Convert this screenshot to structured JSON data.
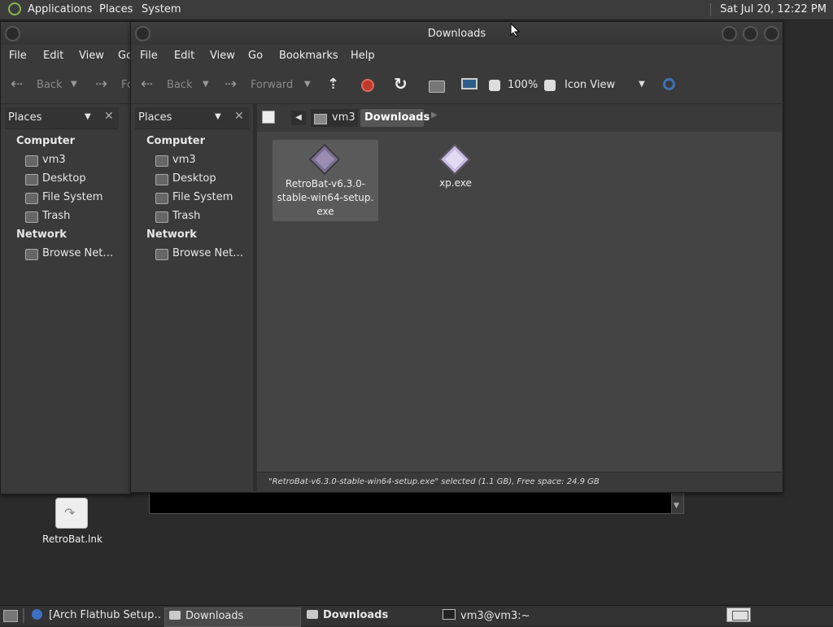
{
  "top_panel": {
    "menus": [
      "Applications",
      "Places",
      "System"
    ],
    "clock": "Sat Jul 20, 12:22 PM"
  },
  "back_window": {
    "menus": [
      "File",
      "Edit",
      "View",
      "Go"
    ],
    "toolbar": {
      "back": "Back",
      "forward": "Fo"
    },
    "places_label": "Places",
    "computer_header": "Computer",
    "items": [
      "vm3",
      "Desktop",
      "File System",
      "Trash"
    ],
    "network_header": "Network",
    "network_items": [
      "Browse Net…"
    ]
  },
  "main_window": {
    "title": "Downloads",
    "menus": [
      "File",
      "Edit",
      "View",
      "Go",
      "Bookmarks",
      "Help"
    ],
    "toolbar": {
      "back": "Back",
      "forward": "Forward",
      "zoom": "100%",
      "view_mode": "Icon View"
    },
    "places_label": "Places",
    "computer_header": "Computer",
    "items": [
      "vm3",
      "Desktop",
      "File System",
      "Trash"
    ],
    "network_header": "Network",
    "network_items": [
      "Browse Net…"
    ],
    "path": [
      "vm3",
      "Downloads"
    ],
    "files": [
      {
        "name_lines": [
          "RetroBat-v6.3.0-",
          "stable-win64-setup.",
          "exe"
        ],
        "selected": true
      },
      {
        "name_lines": [
          "xp.exe"
        ],
        "selected": false
      }
    ],
    "status": "\"RetroBat-v6.3.0-stable-win64-setup.exe\" selected (1.1 GB), Free space: 24.9 GB"
  },
  "desktop": {
    "icon_label": "RetroBat.lnk"
  },
  "taskbar": {
    "tasks": [
      "[Arch Flathub Setup…",
      "Downloads",
      "Downloads",
      "vm3@vm3:~"
    ]
  },
  "colors": {
    "accent_red": "#c0392b",
    "selected_bg": "#5a5a5a"
  }
}
